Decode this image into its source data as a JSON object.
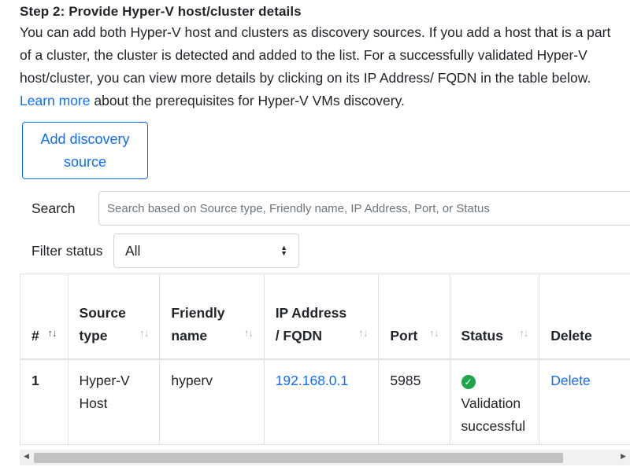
{
  "step": {
    "title": "Step 2: Provide Hyper-V host/cluster details",
    "description_before_link": "You can add both Hyper-V host and clusters as discovery sources. If you add a host that is a part of a cluster, the cluster is detected and added to the list. For a successfully validated Hyper-V host/cluster, you can view more details by clicking on its IP Address/ FQDN in the table below. ",
    "link_text": "Learn more",
    "description_after_link": " about the prerequisites for Hyper-V VMs discovery."
  },
  "add_button": {
    "label": "Add discovery source"
  },
  "search": {
    "label": "Search",
    "placeholder": "Search based on Source type, Friendly name, IP Address, Port, or Status"
  },
  "filter": {
    "label": "Filter status",
    "selected": "All"
  },
  "table": {
    "columns": [
      "#",
      "Source type",
      "Friendly name",
      "IP Address / FQDN",
      "Port",
      "Status",
      "Delete"
    ],
    "rows": [
      {
        "index": "1",
        "source_type": "Hyper-V Host",
        "friendly_name": "hyperv",
        "ip": "192.168.0.1",
        "port": "5985",
        "status": "Validation successful",
        "delete": "Delete"
      }
    ]
  },
  "icons": {
    "sort": "sort-arrows-icon",
    "status": "check-circle-icon",
    "select": "select-caret-icon"
  },
  "colors": {
    "link": "#0d6efd",
    "success": "#1ea44a"
  }
}
